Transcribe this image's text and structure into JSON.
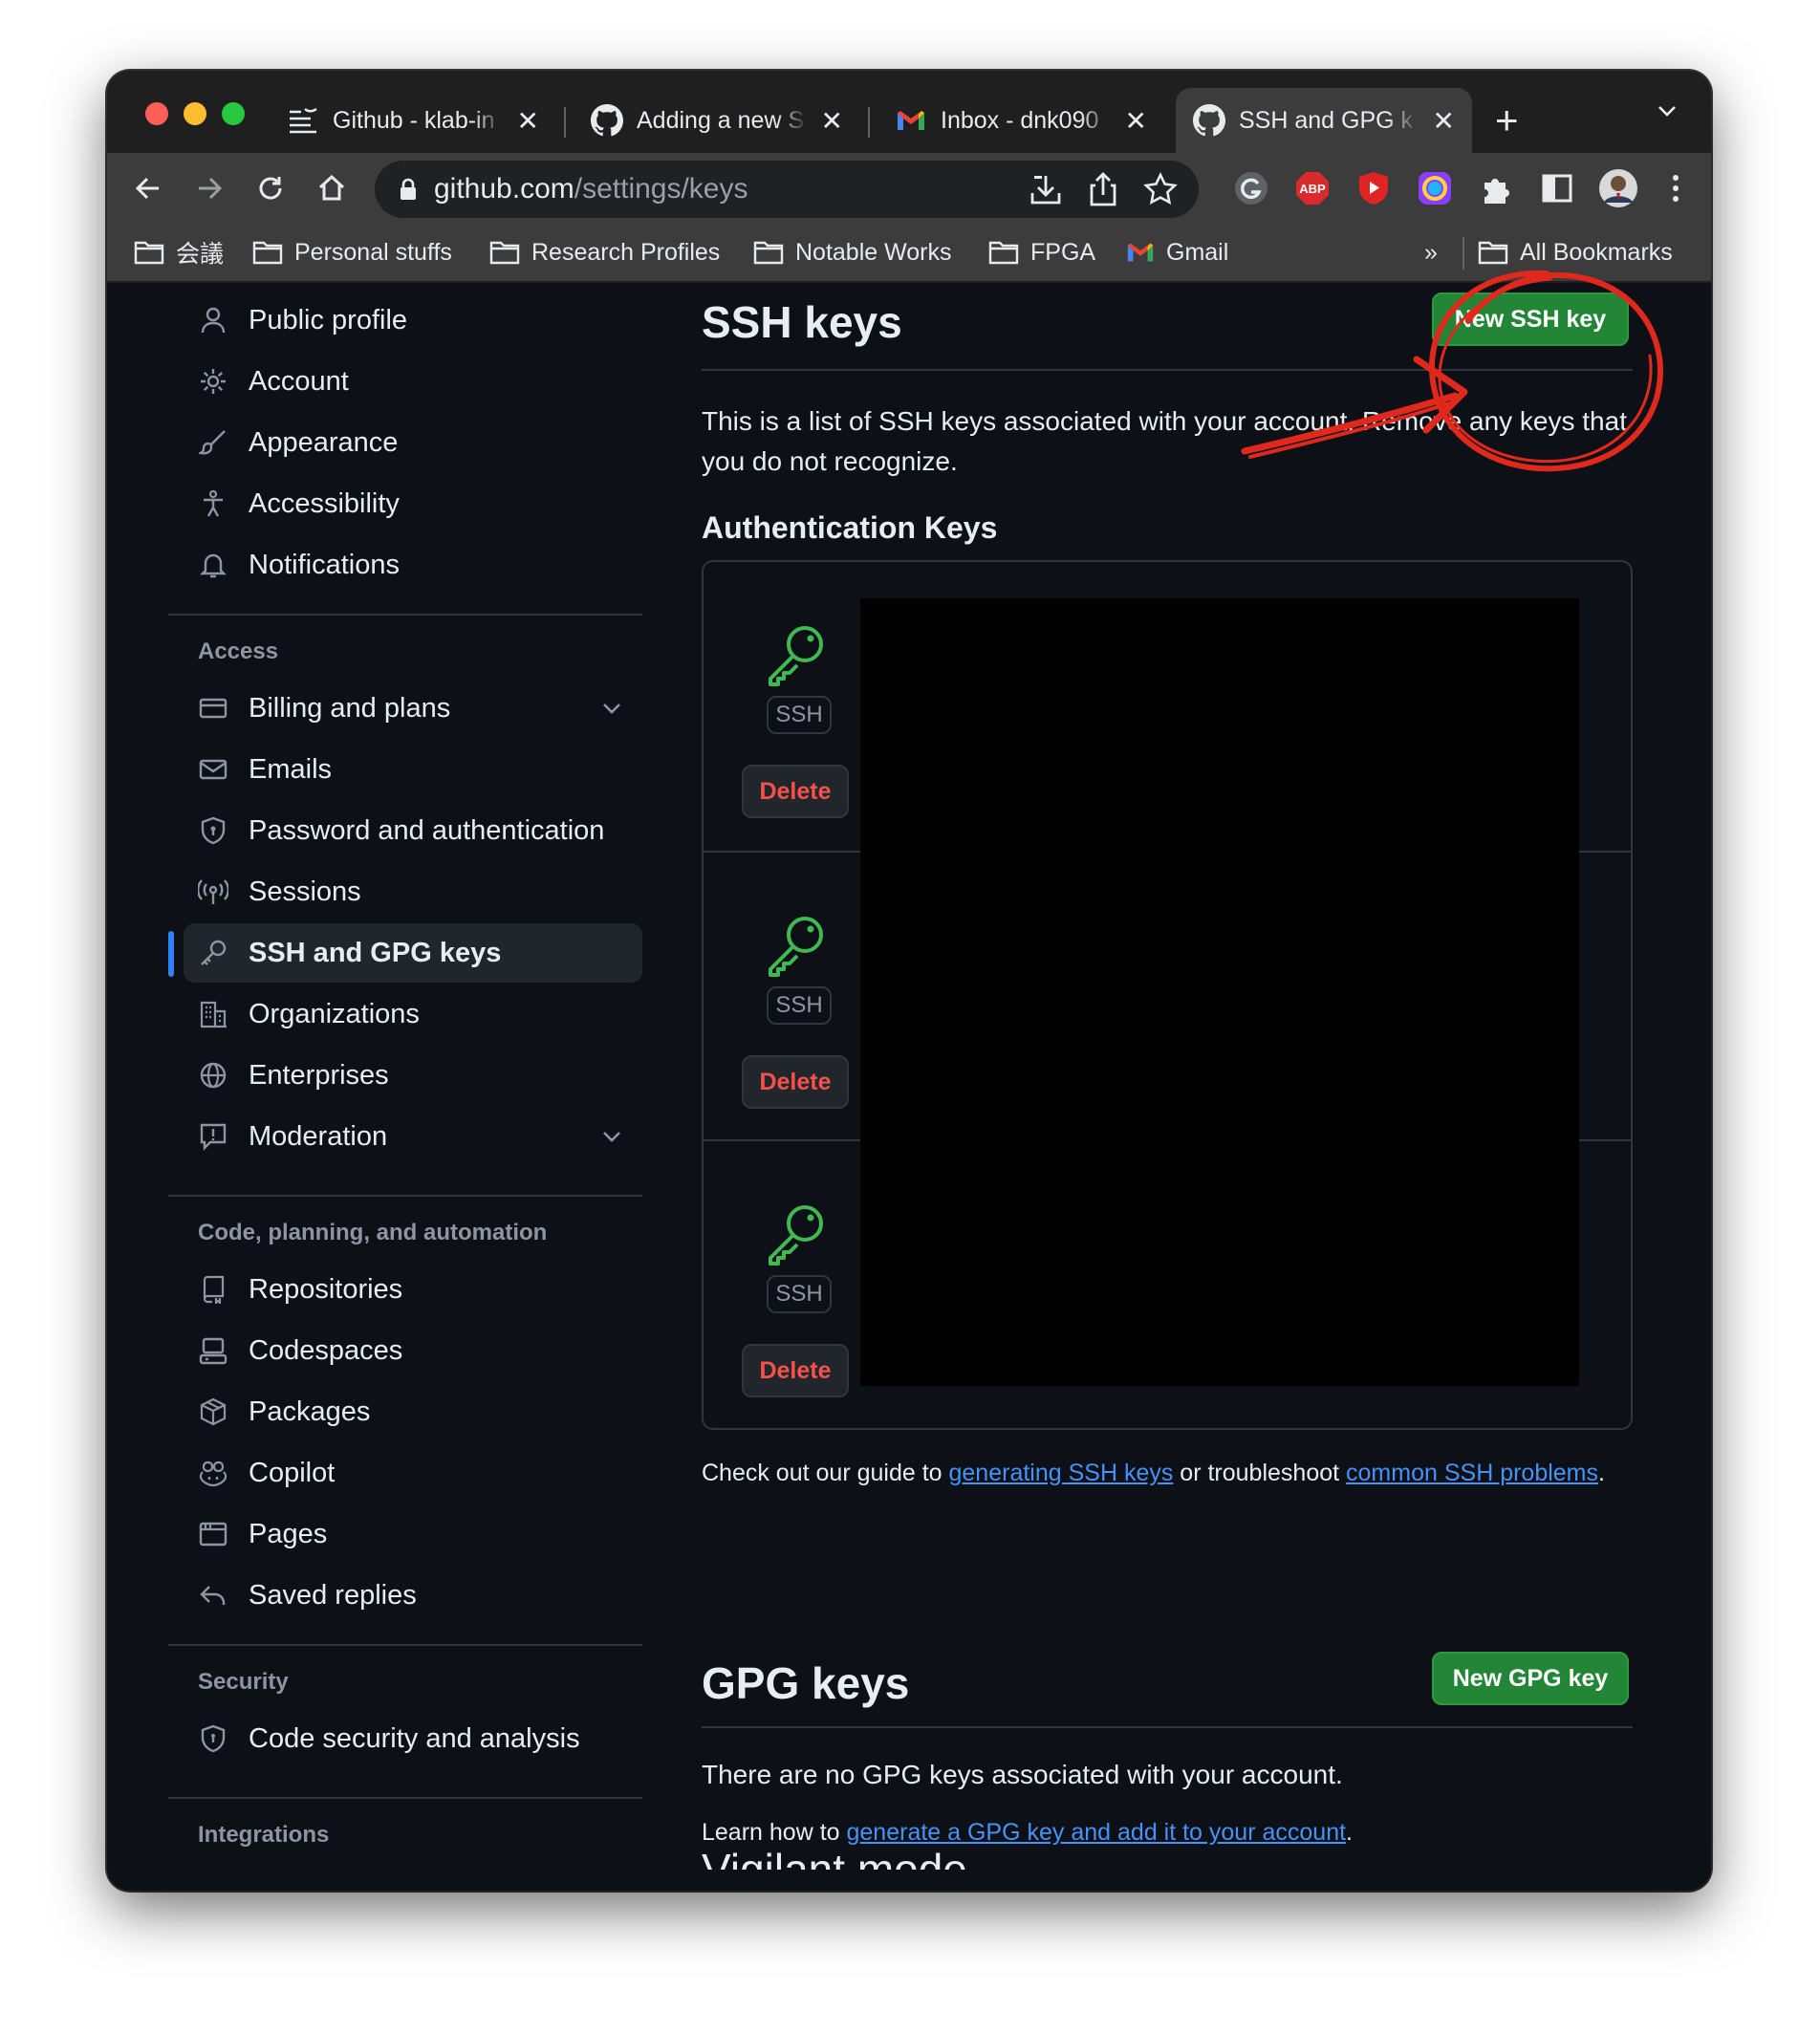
{
  "browser": {
    "tabs": [
      {
        "title": "Github - klab-in",
        "icon": "list-icon",
        "active": false
      },
      {
        "title": "Adding a new S",
        "icon": "github-icon",
        "active": false
      },
      {
        "title": "Inbox - dnk090",
        "icon": "gmail-icon",
        "active": false
      },
      {
        "title": "SSH and GPG k",
        "icon": "github-icon",
        "active": true
      }
    ],
    "tab_close": "✕",
    "new_tab": "+",
    "url_host": "github.com",
    "url_path": "/settings/keys",
    "bookmarks": [
      {
        "label": "会議",
        "icon": "folder-icon"
      },
      {
        "label": "Personal stuffs",
        "icon": "folder-icon"
      },
      {
        "label": "Research Profiles",
        "icon": "folder-icon"
      },
      {
        "label": "Notable Works",
        "icon": "folder-icon"
      },
      {
        "label": "FPGA",
        "icon": "folder-icon"
      },
      {
        "label": "Gmail",
        "icon": "gmail-icon"
      }
    ],
    "bookmarks_overflow": "»",
    "all_bookmarks": "All Bookmarks",
    "extension_abp": "ABP"
  },
  "sidebar": {
    "top_items": [
      {
        "label": "Public profile",
        "icon": "person-icon"
      },
      {
        "label": "Account",
        "icon": "gear-icon"
      },
      {
        "label": "Appearance",
        "icon": "paintbrush-icon"
      },
      {
        "label": "Accessibility",
        "icon": "accessibility-icon"
      },
      {
        "label": "Notifications",
        "icon": "bell-icon"
      }
    ],
    "access_heading": "Access",
    "access_items": [
      {
        "label": "Billing and plans",
        "icon": "credit-card-icon",
        "expandable": true
      },
      {
        "label": "Emails",
        "icon": "mail-icon"
      },
      {
        "label": "Password and authentication",
        "icon": "shield-lock-icon"
      },
      {
        "label": "Sessions",
        "icon": "broadcast-icon"
      },
      {
        "label": "SSH and GPG keys",
        "icon": "key-icon",
        "selected": true
      },
      {
        "label": "Organizations",
        "icon": "organization-icon"
      },
      {
        "label": "Enterprises",
        "icon": "globe-icon"
      },
      {
        "label": "Moderation",
        "icon": "report-icon",
        "expandable": true
      }
    ],
    "code_heading": "Code, planning, and automation",
    "code_items": [
      {
        "label": "Repositories",
        "icon": "repo-icon"
      },
      {
        "label": "Codespaces",
        "icon": "codespaces-icon"
      },
      {
        "label": "Packages",
        "icon": "package-icon"
      },
      {
        "label": "Copilot",
        "icon": "copilot-icon"
      },
      {
        "label": "Pages",
        "icon": "browser-icon"
      },
      {
        "label": "Saved replies",
        "icon": "reply-icon"
      }
    ],
    "security_heading": "Security",
    "security_items": [
      {
        "label": "Code security and analysis",
        "icon": "shield-icon"
      }
    ],
    "integrations_heading": "Integrations"
  },
  "main": {
    "ssh_title": "SSH keys",
    "new_ssh_button": "New SSH key",
    "ssh_description": "This is a list of SSH keys associated with your account. Remove any keys that you do not recognize.",
    "auth_heading": "Authentication Keys",
    "keys": [
      {
        "badge": "SSH",
        "delete_label": "Delete"
      },
      {
        "badge": "SSH",
        "delete_label": "Delete"
      },
      {
        "badge": "SSH",
        "delete_label": "Delete"
      }
    ],
    "guide_prefix": "Check out our guide to ",
    "guide_link1": "generating SSH keys",
    "guide_middle": " or troubleshoot ",
    "guide_link2": "common SSH problems",
    "guide_suffix": ".",
    "gpg_title": "GPG keys",
    "new_gpg_button": "New GPG key",
    "gpg_empty": "There are no GPG keys associated with your account.",
    "gpg_learn_prefix": "Learn how to ",
    "gpg_learn_link": "generate a GPG key and add it to your account",
    "gpg_learn_suffix": ".",
    "cut_off_heading": "Vigilant mode"
  },
  "colors": {
    "accent_green": "#238636",
    "danger_red": "#f85149",
    "link_blue": "#4493f8",
    "annotation_red": "#e0281c",
    "selected_indicator": "#2f81f7"
  }
}
